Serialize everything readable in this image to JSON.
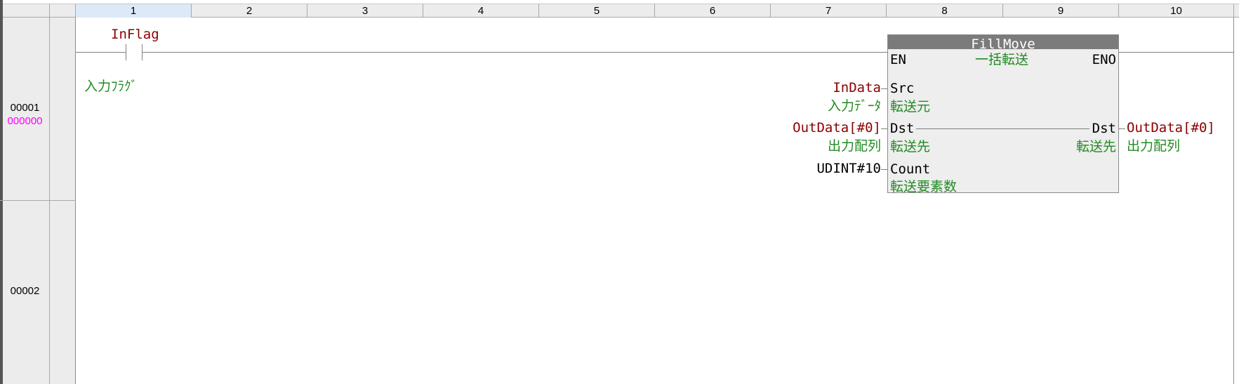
{
  "columns": [
    "1",
    "2",
    "3",
    "4",
    "5",
    "6",
    "7",
    "8",
    "9",
    "10"
  ],
  "rows": [
    {
      "rung": "00001",
      "step": "000000"
    },
    {
      "rung": "00002"
    }
  ],
  "contact": {
    "variable": "InFlag",
    "comment": "入力ﾌﾗｸﾞ"
  },
  "function_block": {
    "name": "FillMove",
    "comment": "一括転送",
    "en": "EN",
    "eno": "ENO",
    "inputs": [
      {
        "pin": "Src",
        "pin_comment": "転送元",
        "variable": "InData",
        "variable_comment": "入力ﾃﾞｰﾀ"
      },
      {
        "pin": "Dst",
        "pin_comment": "転送先",
        "variable": "OutData[#0]",
        "variable_comment": "出力配列"
      },
      {
        "pin": "Count",
        "pin_comment": "転送要素数",
        "literal": "UDINT#10"
      }
    ],
    "output": {
      "pin": "Dst",
      "pin_comment": "転送先",
      "variable": "OutData[#0]",
      "variable_comment": "出力配列"
    }
  },
  "colors": {
    "variable": "#8b0000",
    "comment": "#228b22",
    "step": "#ff00ff",
    "block_title": "#7b7b7b"
  }
}
